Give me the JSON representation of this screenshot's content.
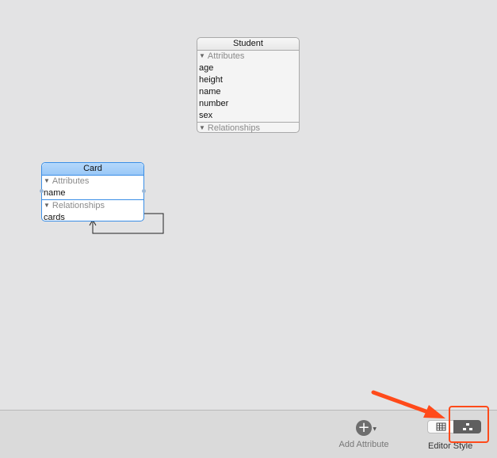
{
  "entities": {
    "student": {
      "title": "Student",
      "attributes_label": "Attributes",
      "attributes": [
        "age",
        "height",
        "name",
        "number",
        "sex"
      ],
      "relationships_label": "Relationships"
    },
    "card": {
      "title": "Card",
      "attributes_label": "Attributes",
      "attributes": [
        "name"
      ],
      "relationships_label": "Relationships",
      "relationships": [
        "cards"
      ]
    }
  },
  "toolbar": {
    "add_attribute_label": "Add Attribute",
    "editor_style_label": "Editor Style",
    "editor_style_selected": "graph"
  },
  "icons": {
    "add": "plus-circle-icon",
    "table_style": "table-grid-icon",
    "graph_style": "graph-nodes-icon"
  },
  "colors": {
    "selection": "#3a8ee6",
    "annotation": "#ff4a1a"
  }
}
